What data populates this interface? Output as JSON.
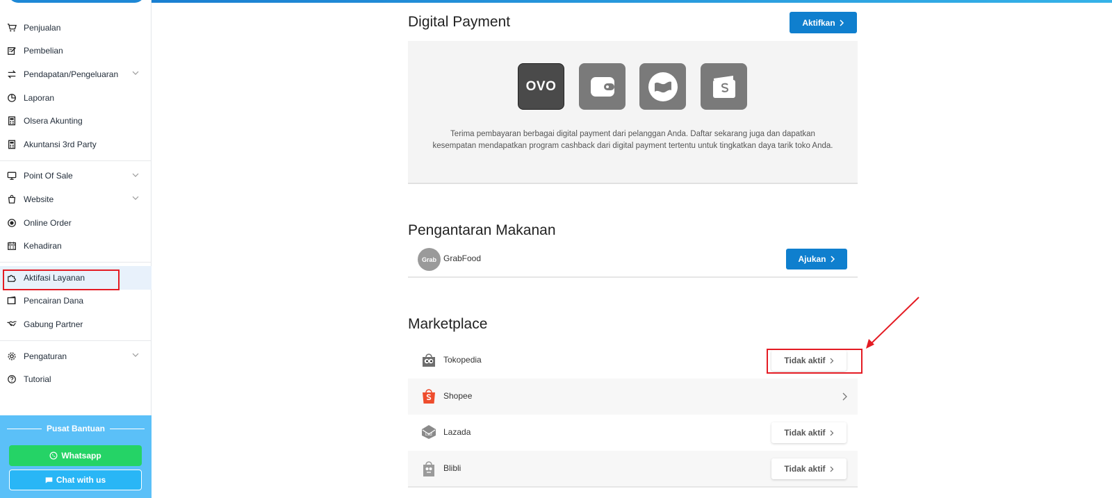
{
  "sidebar": {
    "items": [
      {
        "label": "Penjualan",
        "icon": "cart-icon"
      },
      {
        "label": "Pembelian",
        "icon": "edit-doc-icon"
      },
      {
        "label": "Pendapatan/Pengeluaran",
        "icon": "swap-icon",
        "expandable": true
      },
      {
        "label": "Laporan",
        "icon": "pie-chart-icon"
      },
      {
        "label": "Olsera Akunting",
        "icon": "calculator-icon"
      },
      {
        "label": "Akuntansi 3rd Party",
        "icon": "calculator-icon"
      },
      {
        "label": "Point Of Sale",
        "icon": "monitor-icon",
        "expandable": true
      },
      {
        "label": "Website",
        "icon": "shopping-bag-icon",
        "expandable": true
      },
      {
        "label": "Online Order",
        "icon": "radio-icon"
      },
      {
        "label": "Kehadiran",
        "icon": "calendar-icon"
      },
      {
        "label": "Aktifasi Layanan",
        "icon": "puzzle-icon",
        "active": true
      },
      {
        "label": "Pencairan Dana",
        "icon": "wallet-icon"
      },
      {
        "label": "Gabung Partner",
        "icon": "handshake-icon"
      },
      {
        "label": "Pengaturan",
        "icon": "gear-icon",
        "expandable": true
      },
      {
        "label": "Tutorial",
        "icon": "help-circle-icon"
      }
    ],
    "help": {
      "title": "Pusat Bantuan",
      "whatsapp_label": "Whatsapp",
      "chat_label": "Chat with us"
    }
  },
  "digital_payment": {
    "title": "Digital Payment",
    "button_label": "Aktifkan",
    "providers": [
      {
        "label": "OVO",
        "icon": "ovo-logo"
      },
      {
        "label": "",
        "icon": "wallet-app-icon"
      },
      {
        "label": "",
        "icon": "flag-app-icon"
      },
      {
        "label": "",
        "icon": "s-wallet-app-icon"
      }
    ],
    "description": "Terima pembayaran berbagai digital payment dari pelanggan Anda. Daftar sekarang juga dan dapatkan kesempatan mendapatkan program cashback dari digital payment tertentu untuk tingkatkan daya tarik toko Anda."
  },
  "food_delivery": {
    "title": "Pengantaran Makanan",
    "items": [
      {
        "logo_text": "Grab",
        "label": "GrabFood",
        "button_label": "Ajukan"
      }
    ]
  },
  "marketplace": {
    "title": "Marketplace",
    "items": [
      {
        "label": "Tokopedia",
        "status": "Tidak aktif"
      },
      {
        "label": "Shopee",
        "status": ""
      },
      {
        "label": "Lazada",
        "status": "Tidak aktif"
      },
      {
        "label": "Blibli",
        "status": "Tidak aktif"
      }
    ]
  },
  "colors": {
    "primary": "#0f7fce",
    "help_bg": "#5bc0f8",
    "whatsapp": "#25d366",
    "annotation": "#e41b23"
  }
}
